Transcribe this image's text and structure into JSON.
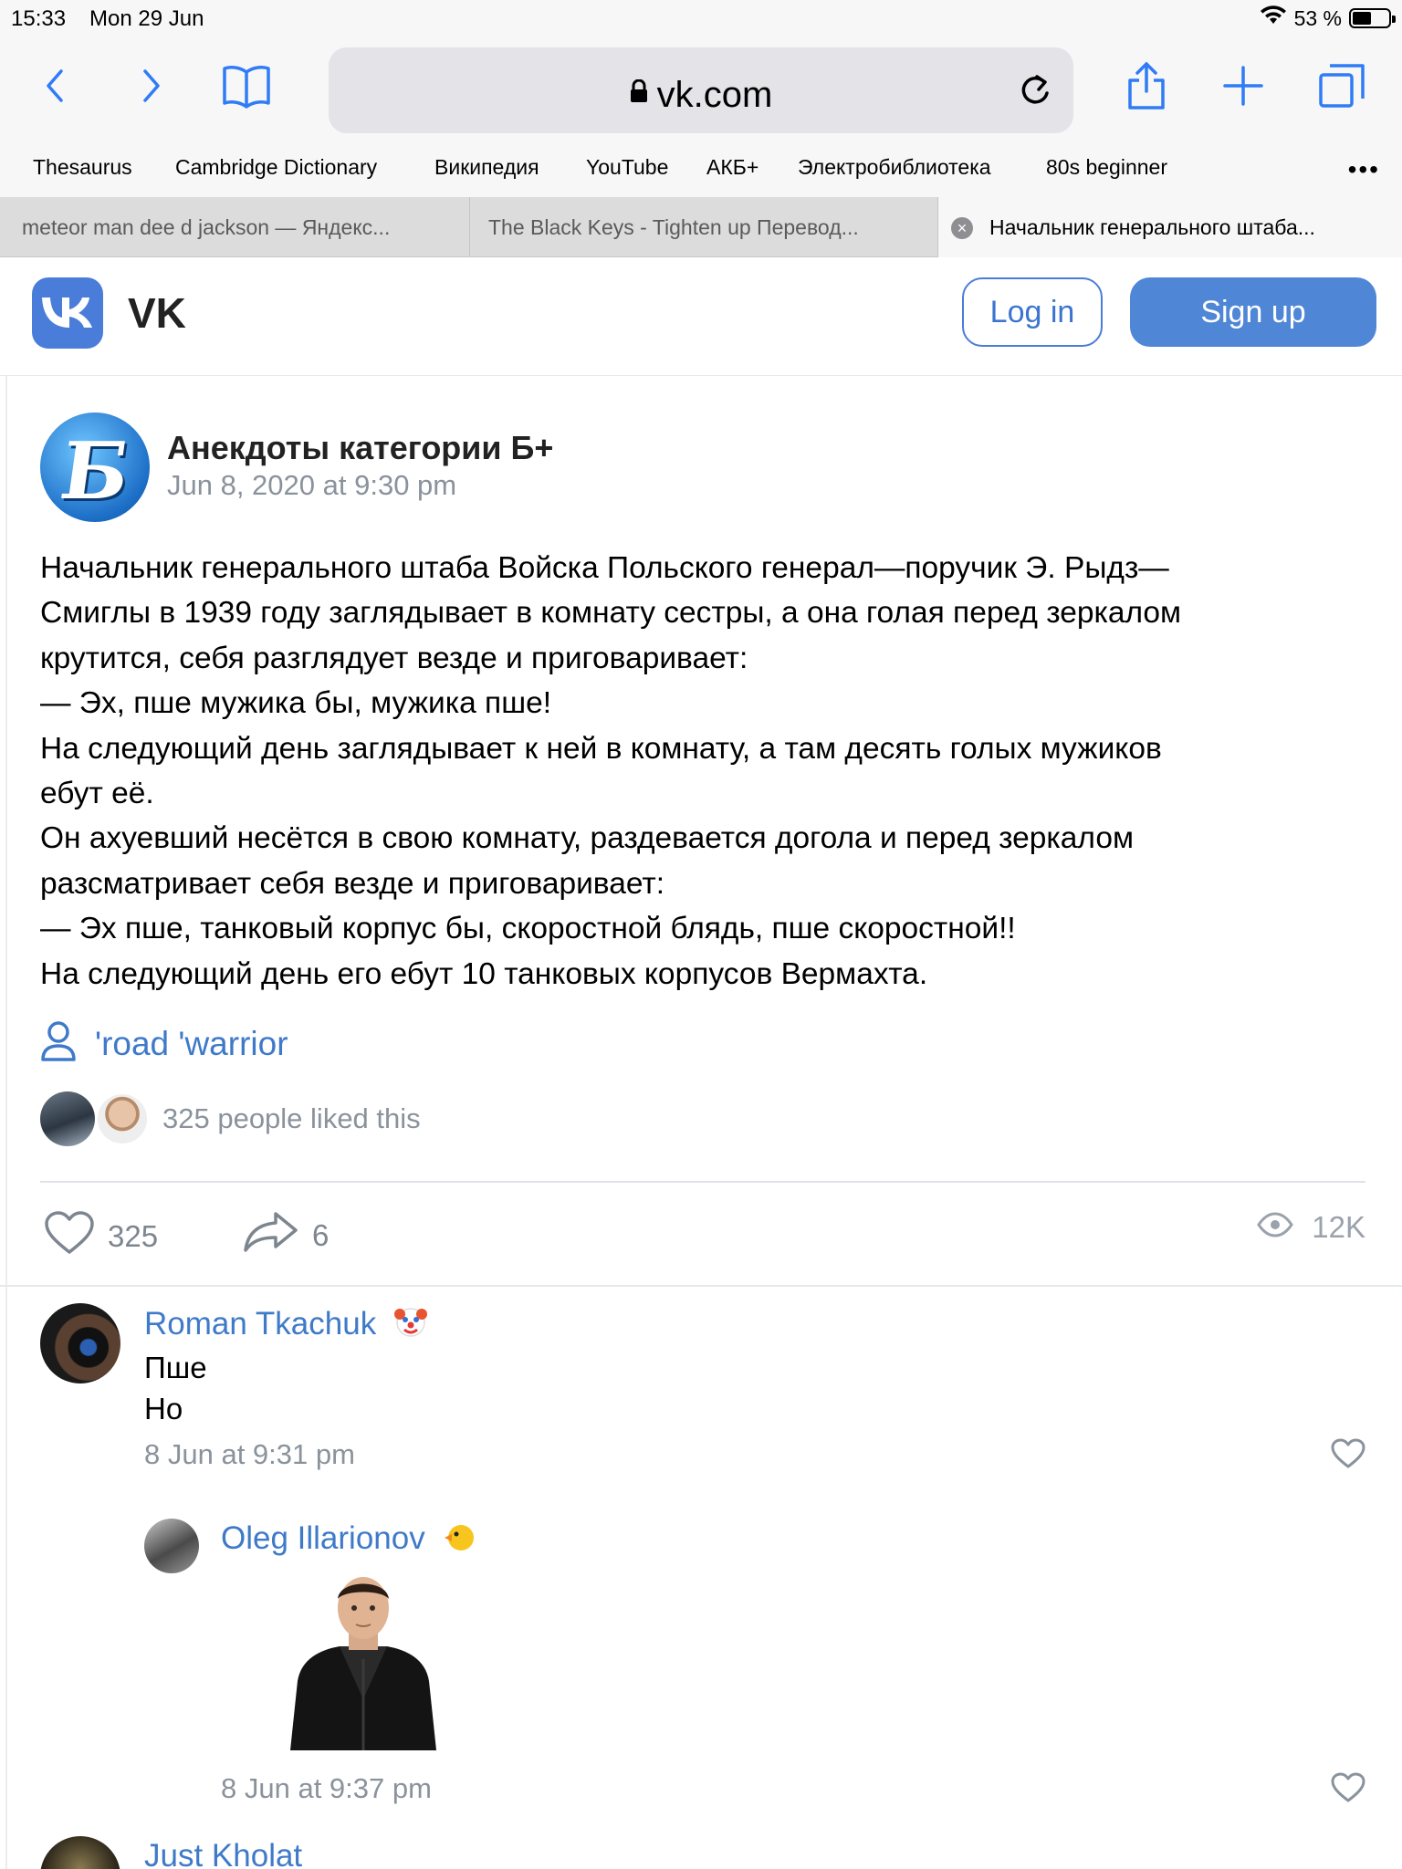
{
  "status_bar": {
    "time": "15:33",
    "date": "Mon 29 Jun",
    "battery": "53 %",
    "battery_level": 0.53
  },
  "browser": {
    "url": "vk.com",
    "favorites": [
      "Thesaurus",
      "Cambridge Dictionary",
      "Википедия",
      "YouTube",
      "АКБ+",
      "Электробиблиотека",
      "80s beginner"
    ],
    "more": "•••",
    "tabs": [
      {
        "title": "meteor man dee d jackson — Яндекс..."
      },
      {
        "title": "The Black Keys - Tighten up Перевод..."
      },
      {
        "title": "Начальник генерального штаба..."
      }
    ],
    "active_tab": 2
  },
  "vk_header": {
    "logo_text": "VK",
    "wordmark": "VK",
    "login": "Log in",
    "signup": "Sign up",
    "accent_color": "#4a7dd9"
  },
  "post": {
    "author": "Анекдоты категории Б+",
    "date": "Jun 8, 2020 at 9:30 pm",
    "avatar_letter": "Б",
    "text_lines": [
      "Начальник генерального штаба Войска Польского генерал—поручик Э. Рыдз—",
      "Смиглы в 1939 году заглядывает в комнату сестры, а она голая перед зеркалом",
      "крутится, себя разглядует везде и приговаривает:",
      "— Эх, пше мужика бы, мужика пше!",
      "На следующий день заглядывает к ней в комнату, а там десять голых мужиков",
      "ебут её.",
      "Он ахуевший несётся в свою комнату, раздевается догола и перед зеркалом",
      "разсматривает себя везде и приговаривает:",
      "— Эх пше, танковый корпус бы, скоростной блядь, пше скоростной!!",
      "На следующий день его ебут 10 танковых корпусов Вермахта."
    ],
    "signer": "'road 'warrior",
    "liked_text": "325 people liked this",
    "likes": "325",
    "shares": "6",
    "views": "12K"
  },
  "comments": [
    {
      "author": "Roman Tkachuk",
      "emoji": "clown-face",
      "text_lines": [
        "Пше",
        "Но"
      ],
      "date": "8 Jun at 9:31 pm"
    },
    {
      "author": "Oleg Illarionov",
      "emoji": "chick",
      "sticker": "man-in-leather-jacket-sticker",
      "date": "8 Jun at 9:37 pm"
    },
    {
      "author": "Just Kholat"
    }
  ]
}
